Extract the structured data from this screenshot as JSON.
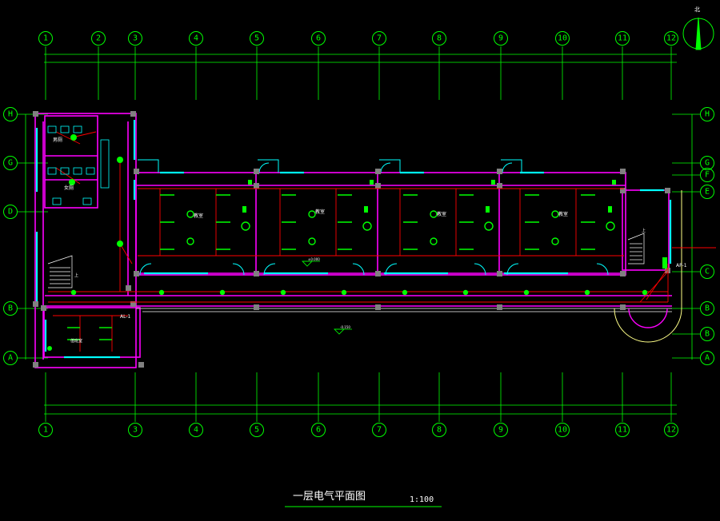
{
  "title": "一层电气平面图",
  "scale": "1:100",
  "north_label": "北",
  "axes_top": [
    "1",
    "2",
    "3",
    "4",
    "5",
    "6",
    "7",
    "8",
    "9",
    "10",
    "11",
    "12"
  ],
  "axes_bottom": [
    "1",
    "3",
    "4",
    "5",
    "6",
    "7",
    "8",
    "9",
    "10",
    "11",
    "12"
  ],
  "axes_left": [
    "H",
    "G",
    "D",
    "B",
    "A"
  ],
  "axes_right": [
    "H",
    "G",
    "F",
    "E",
    "C",
    "B",
    "B",
    "A"
  ],
  "room_labels": {
    "toilet_m": "男厕",
    "toilet_f": "女厕",
    "stair_dn": "上",
    "stair_up": "上",
    "office1": "教室",
    "office2": "教室",
    "office3": "教室",
    "office4": "教室",
    "guard": "值班室",
    "panel_1": "AL-1",
    "panel_2": "AP-1",
    "elev_1": "±0.000",
    "elev_2": "-0.150"
  },
  "colors": {
    "grid": "#00ff00",
    "wall": "#ff00ff",
    "circuit": "#ff0000",
    "window": "#00ffff",
    "column": "#808080",
    "fixture": "#00ff00",
    "text": "#ffffff"
  }
}
